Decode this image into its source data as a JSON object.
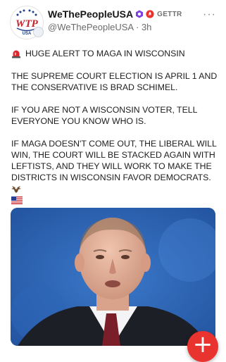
{
  "post": {
    "author": {
      "display_name": "WeThePeopleUSA",
      "platform_label": "GETTR",
      "handle": "@WeThePeopleUSA",
      "separator": "·",
      "time": "3h",
      "logo_text": "WTP",
      "logo_subtext": "USA"
    },
    "more_label": "···",
    "paragraphs": [
      "HUGE ALERT TO MAGA IN WISCONSIN",
      "THE SUPREME COURT ELECTION IS APRIL 1 AND THE CONSERVATIVE IS BRAD SCHIMEL.",
      "IF YOU ARE NOT A WISCONSIN VOTER, TELL EVERYONE YOU KNOW WHO IS.",
      "IF MAGA DOESN'T COME OUT, THE LIBERAL WILL WIN, THE COURT WILL BE STACKED AGAIN WITH LEFTISTS, AND THEY WILL WORK TO MAKE THE DISTRICTS IN WISCONSIN FAVOR DEMOCRATS."
    ],
    "icons": {
      "alert": "police-light-icon",
      "eagle": "eagle-icon",
      "flag": "us-flag-icon"
    }
  },
  "fab_label": "+",
  "colors": {
    "accent": "#e8332f",
    "badge_purple": "#7b3fe4",
    "badge_red": "#e8332f",
    "photo_background": "#2a63b3"
  }
}
